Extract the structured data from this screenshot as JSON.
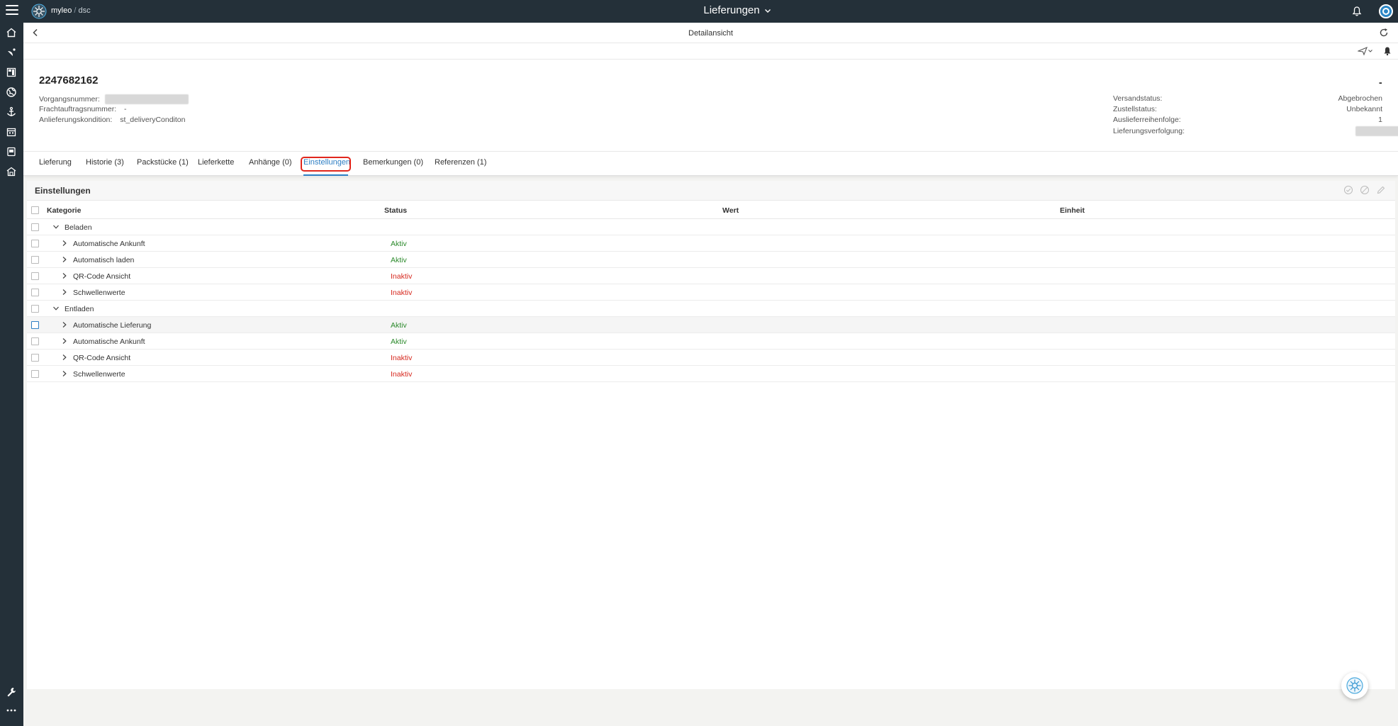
{
  "topbar": {
    "brand_name": "myleo",
    "brand_sep": "/",
    "brand_sub": "dsc",
    "app_title": "Lieferungen"
  },
  "subheader": {
    "title": "Detailansicht"
  },
  "header": {
    "doc_number": "2247682162",
    "status_dash": "-",
    "left": [
      {
        "label": "Vorgangsnummer:",
        "value": ""
      },
      {
        "label": "Frachtauftragsnummer:",
        "value": "-"
      },
      {
        "label": "Anlieferungskondition:",
        "value": "st_deliveryConditon"
      }
    ],
    "right": [
      {
        "label": "Versandstatus:",
        "value": "Abgebrochen"
      },
      {
        "label": "Zustellstatus:",
        "value": "Unbekannt"
      },
      {
        "label": "Auslieferreihenfolge:",
        "value": "1"
      },
      {
        "label": "Lieferungsverfolgung:",
        "value": ""
      }
    ]
  },
  "tabs": [
    {
      "label": "Lieferung"
    },
    {
      "label": "Historie (3)"
    },
    {
      "label": "Packstücke (1)"
    },
    {
      "label": "Lieferkette"
    },
    {
      "label": "Anhänge (0)"
    },
    {
      "label": "Einstellungen"
    },
    {
      "label": "Bemerkungen (0)"
    },
    {
      "label": "Referenzen (1)"
    }
  ],
  "panel": {
    "title": "Einstellungen",
    "columns": [
      "Kategorie",
      "Status",
      "Wert",
      "Einheit"
    ],
    "groups": [
      {
        "name": "Beladen",
        "items": [
          {
            "name": "Automatische Ankunft",
            "status": "Aktiv"
          },
          {
            "name": "Automatisch laden",
            "status": "Aktiv"
          },
          {
            "name": "QR-Code Ansicht",
            "status": "Inaktiv"
          },
          {
            "name": "Schwellenwerte",
            "status": "Inaktiv"
          }
        ]
      },
      {
        "name": "Entladen",
        "items": [
          {
            "name": "Automatische Lieferung",
            "status": "Aktiv"
          },
          {
            "name": "Automatische Ankunft",
            "status": "Aktiv"
          },
          {
            "name": "QR-Code Ansicht",
            "status": "Inaktiv"
          },
          {
            "name": "Schwellenwerte",
            "status": "Inaktiv"
          }
        ]
      }
    ]
  },
  "colors": {
    "topbar": "#243039",
    "accent": "#2e7fc4",
    "active_status": "#2c8a2c",
    "inactive_status": "#d6281e",
    "highlight": "#e1261c"
  }
}
